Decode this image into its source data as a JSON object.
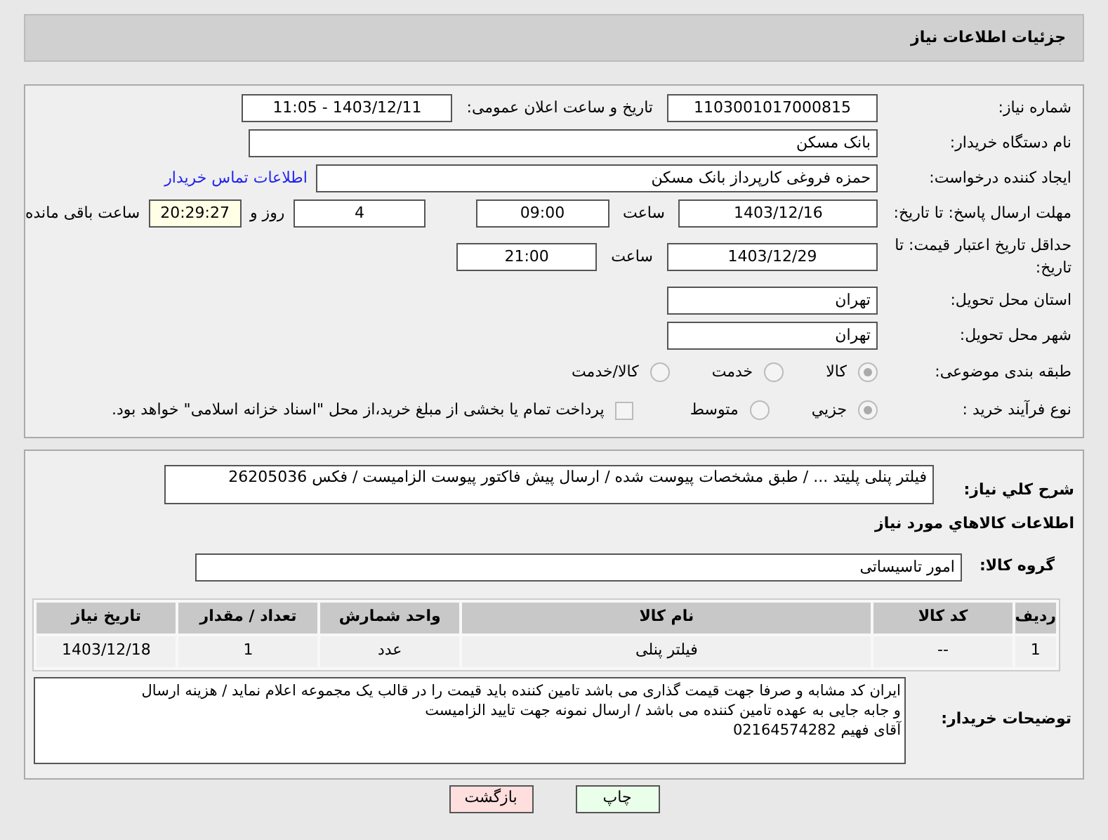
{
  "header": {
    "title": "جزئیات اطلاعات نیاز"
  },
  "details": {
    "need_number": {
      "label": "شماره نیاز:",
      "value": "1103001017000815"
    },
    "announce": {
      "label": "تاریخ و ساعت اعلان عمومی:",
      "value": "1403/12/11 - 11:05"
    },
    "buyer_org": {
      "label": "نام دستگاه خریدار:",
      "value": "بانک مسکن"
    },
    "requester": {
      "label": "ایجاد کننده درخواست:",
      "value": "حمزه فروغی کارپرداز بانک مسکن",
      "link": "اطلاعات تماس خریدار"
    },
    "reply_deadline": {
      "label": "مهلت ارسال پاسخ: تا تاریخ:",
      "date": "1403/12/16",
      "time_label": "ساعت",
      "time": "09:00",
      "days": "4",
      "days_label": "روز و",
      "remaining": "20:29:27",
      "remaining_label": "ساعت باقی مانده"
    },
    "price_validity": {
      "label": "حداقل تاریخ اعتبار قیمت: تا تاریخ:",
      "date": "1403/12/29",
      "time_label": "ساعت",
      "time": "21:00"
    },
    "province": {
      "label": "استان محل تحویل:",
      "value": "تهران"
    },
    "city": {
      "label": "شهر محل تحویل:",
      "value": "تهران"
    },
    "category": {
      "label": "طبقه بندی موضوعی:",
      "options": [
        {
          "label": "کالا",
          "selected": true
        },
        {
          "label": "خدمت",
          "selected": false
        },
        {
          "label": "کالا/خدمت",
          "selected": false
        }
      ]
    },
    "process": {
      "label": "نوع فرآیند خرید :",
      "options": [
        {
          "label": "جزیي",
          "selected": true
        },
        {
          "label": "متوسط",
          "selected": false
        }
      ],
      "payment": {
        "checked": false,
        "text": "پرداخت تمام یا بخشی از مبلغ خرید،از محل \"اسناد خزانه اسلامی\" خواهد بود."
      }
    }
  },
  "items": {
    "description": {
      "label": "شرح کلي نياز:",
      "value": "فیلتر پنلی پلیتد ... / طبق مشخصات پیوست شده / ارسال پیش فاکتور پیوست الزامیست / فکس 26205036"
    },
    "heading": "اطلاعات کالاهاي مورد نياز",
    "group": {
      "label": "گروه کالا:",
      "value": "امور تاسیساتی"
    },
    "table": {
      "columns": [
        "ردیف",
        "کد کالا",
        "نام کالا",
        "واحد شمارش",
        "تعداد / مقدار",
        "تاریخ نیاز"
      ],
      "rows": [
        [
          "1",
          "--",
          "فیلتر پنلی",
          "عدد",
          "1",
          "1403/12/18"
        ]
      ]
    },
    "notes": {
      "label": "توضیحات خریدار:",
      "lines": [
        "ایران کد مشابه و صرفا جهت قیمت گذاری می باشد تامین کننده باید قیمت  را در قالب یک مجموعه اعلام نماید / هزینه ارسال",
        "و جابه جایی به عهده تامین کننده می باشد / ارسال نمونه جهت تایید الزامیست",
        "آقای فهیم 02164574282"
      ]
    }
  },
  "buttons": [
    {
      "label": "چاپ",
      "kind": "print"
    },
    {
      "label": "بازگشت",
      "kind": "back"
    }
  ]
}
